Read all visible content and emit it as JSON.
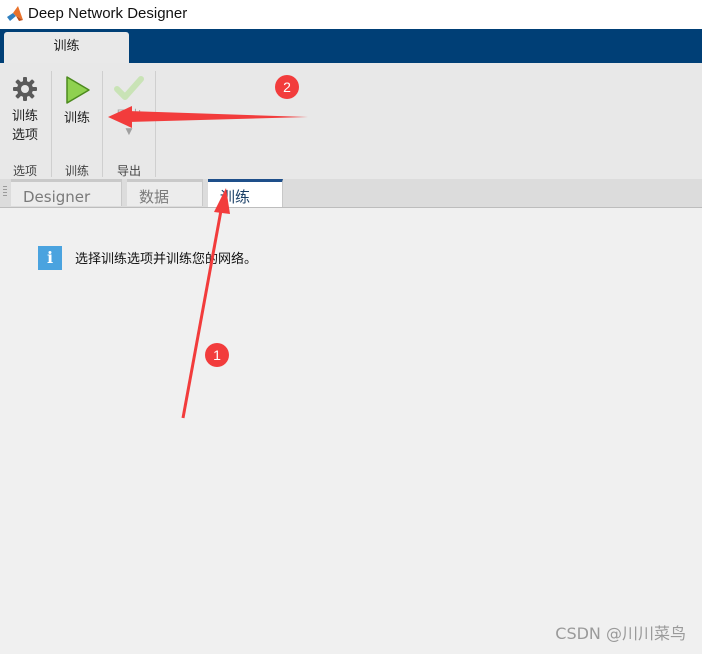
{
  "window": {
    "title": "Deep Network Designer"
  },
  "ribbon_tabs": [
    {
      "label": "训练",
      "active": true
    }
  ],
  "ribbon": {
    "groups": [
      {
        "label": "选项",
        "buttons": [
          {
            "label_line1": "训练",
            "label_line2": "选项",
            "icon": "gear-icon",
            "enabled": true
          }
        ]
      },
      {
        "label": "训练",
        "buttons": [
          {
            "label": "训练",
            "icon": "play-icon",
            "enabled": true
          }
        ]
      },
      {
        "label": "导出",
        "buttons": [
          {
            "label": "导出",
            "icon": "checkmark-icon",
            "enabled": false,
            "has_dropdown": true
          }
        ]
      }
    ]
  },
  "doc_tabs": [
    {
      "label": "Designer",
      "active": false
    },
    {
      "label": "数据",
      "active": false
    },
    {
      "label": "训练",
      "active": true
    }
  ],
  "content": {
    "info_message": "选择训练选项并训练您的网络。"
  },
  "annotations": [
    {
      "label": "1"
    },
    {
      "label": "2"
    }
  ],
  "colors": {
    "tabstrip": "#003f76",
    "annotation_red": "#f23c3c",
    "info_blue": "#4aa3df",
    "play_green": "#7cc242"
  },
  "watermark": "CSDN @川川菜鸟"
}
